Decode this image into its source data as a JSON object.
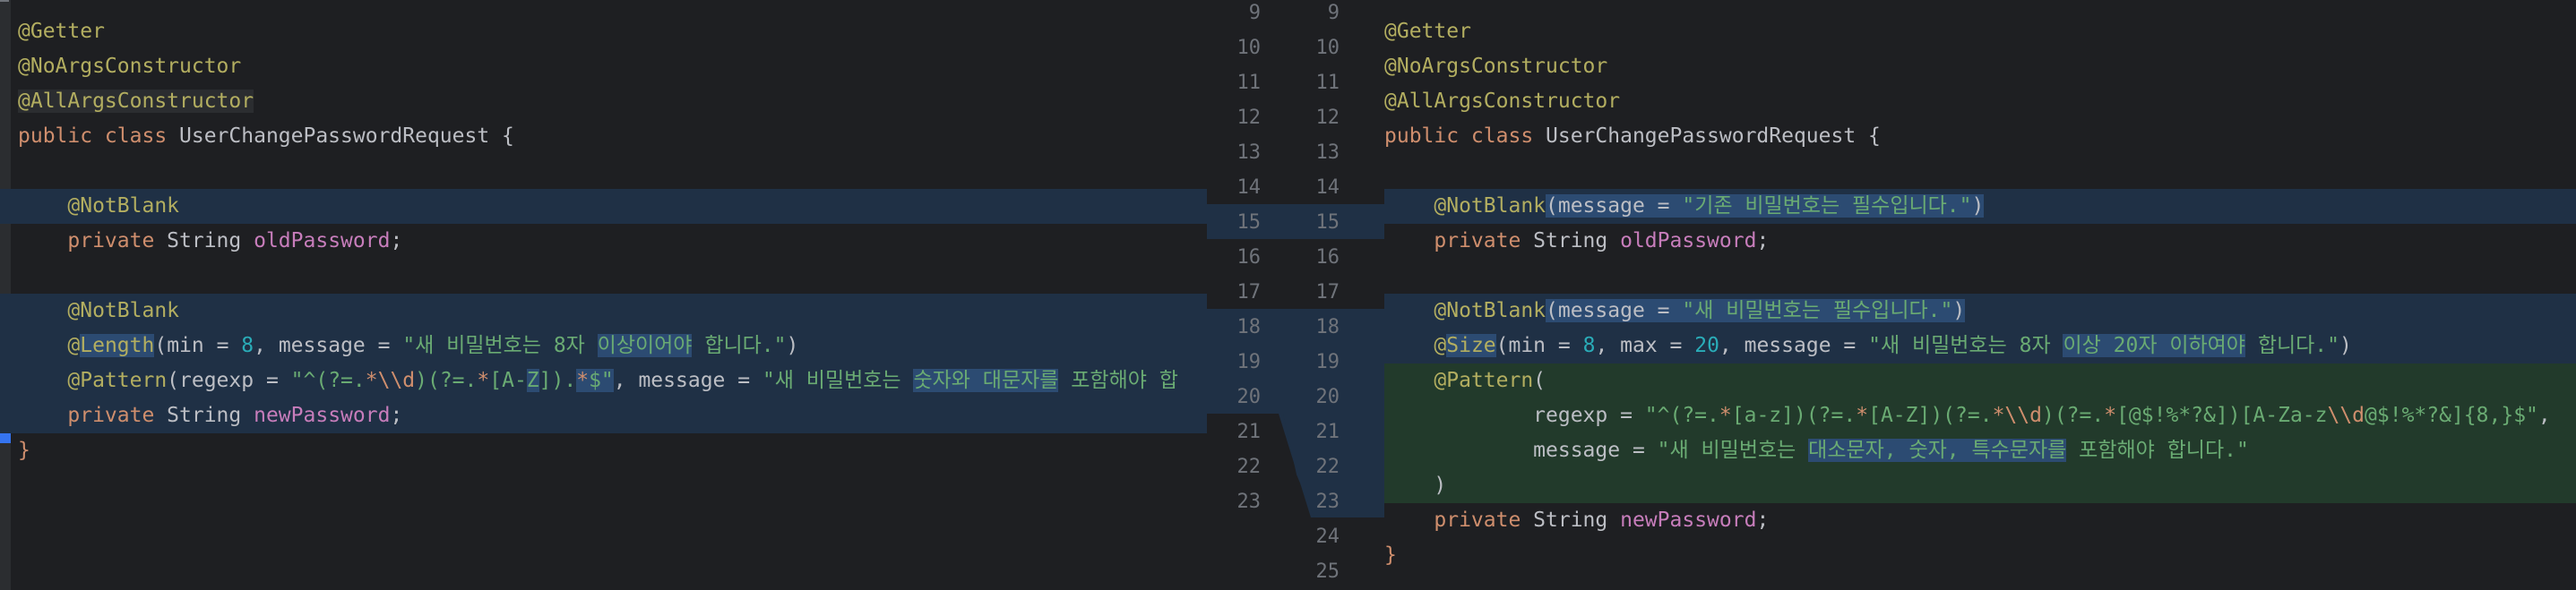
{
  "left": {
    "lines": [
      {
        "segs": [
          {
            "t": "@Getter",
            "c": "ann"
          }
        ]
      },
      {
        "segs": [
          {
            "t": "@NoArgsConstructor",
            "c": "ann"
          }
        ]
      },
      {
        "segs": [
          {
            "t": "@AllArgsConstructor",
            "c": "ann annbox"
          }
        ]
      },
      {
        "segs": [
          {
            "t": "public class ",
            "c": "kw"
          },
          {
            "t": "UserChangePasswordRequest {",
            "c": ""
          }
        ]
      },
      {
        "segs": [
          {
            "t": "",
            "c": ""
          }
        ]
      },
      {
        "segs": [
          {
            "t": "    @NotBlank",
            "c": "ann"
          }
        ]
      },
      {
        "segs": [
          {
            "t": "    private ",
            "c": "kw"
          },
          {
            "t": "String ",
            "c": ""
          },
          {
            "t": "oldPassword",
            "c": "fld"
          },
          {
            "t": ";",
            "c": ""
          }
        ]
      },
      {
        "segs": [
          {
            "t": "",
            "c": ""
          }
        ]
      },
      {
        "segs": [
          {
            "t": "    @NotBlank",
            "c": "ann"
          }
        ]
      },
      {
        "segs": [
          {
            "t": "    @",
            "c": "ann"
          },
          {
            "t": "Length",
            "c": "ann chg"
          },
          {
            "t": "(min = ",
            "c": ""
          },
          {
            "t": "8",
            "c": "num"
          },
          {
            "t": ", message = ",
            "c": ""
          },
          {
            "t": "\"새 비밀번호는 8자 ",
            "c": "str"
          },
          {
            "t": "이상이어야",
            "c": "str chg"
          },
          {
            "t": " 합니다.\"",
            "c": "str"
          },
          {
            "t": ")",
            "c": ""
          }
        ]
      },
      {
        "segs": [
          {
            "t": "    @Pattern",
            "c": "ann"
          },
          {
            "t": "(regexp = ",
            "c": ""
          },
          {
            "t": "\"^(?=.",
            "c": "str"
          },
          {
            "t": "*\\\\d",
            "c": "esc"
          },
          {
            "t": ")(?=.",
            "c": "str"
          },
          {
            "t": "*",
            "c": "esc"
          },
          {
            "t": "[A-",
            "c": "str"
          },
          {
            "t": "Z",
            "c": "str chg"
          },
          {
            "t": "]).",
            "c": "str"
          },
          {
            "t": "*",
            "c": "esc chg"
          },
          {
            "t": "$\"",
            "c": "str chg"
          },
          {
            "t": ", message = ",
            "c": ""
          },
          {
            "t": "\"새 비밀번호는 ",
            "c": "str"
          },
          {
            "t": "숫자와 대문자를",
            "c": "str chg"
          },
          {
            "t": " 포함해야 합",
            "c": "str"
          }
        ]
      },
      {
        "segs": [
          {
            "t": "    private ",
            "c": "kw"
          },
          {
            "t": "String ",
            "c": ""
          },
          {
            "t": "newPassword",
            "c": "fld"
          },
          {
            "t": ";",
            "c": ""
          }
        ]
      },
      {
        "segs": [
          {
            "t": "}",
            "c": "kw"
          }
        ]
      }
    ]
  },
  "gutter": {
    "left_numbers": [
      "9",
      "10",
      "11",
      "12",
      "13",
      "14",
      "15",
      "16",
      "17",
      "18",
      "19",
      "20",
      "21",
      "22",
      "23"
    ],
    "right_numbers": [
      "9",
      "10",
      "11",
      "12",
      "13",
      "14",
      "15",
      "16",
      "17",
      "18",
      "19",
      "20",
      "21",
      "22",
      "23",
      "24",
      "25"
    ]
  },
  "right": {
    "lines": [
      {
        "segs": [
          {
            "t": "@Getter",
            "c": "ann"
          }
        ]
      },
      {
        "segs": [
          {
            "t": "@NoArgsConstructor",
            "c": "ann"
          }
        ]
      },
      {
        "segs": [
          {
            "t": "@AllArgsConstructor",
            "c": "ann"
          }
        ]
      },
      {
        "segs": [
          {
            "t": "public class ",
            "c": "kw"
          },
          {
            "t": "UserChangePasswordRequest {",
            "c": ""
          }
        ]
      },
      {
        "segs": [
          {
            "t": "",
            "c": ""
          }
        ]
      },
      {
        "segs": [
          {
            "t": "    @NotBlank",
            "c": "ann"
          },
          {
            "t": "(message = ",
            "c": "chg"
          },
          {
            "t": "\"기존 비밀번호는 필수입니다.\"",
            "c": "str chg"
          },
          {
            "t": ")",
            "c": "chg"
          }
        ]
      },
      {
        "segs": [
          {
            "t": "    private ",
            "c": "kw"
          },
          {
            "t": "String ",
            "c": ""
          },
          {
            "t": "oldPassword",
            "c": "fld"
          },
          {
            "t": ";",
            "c": ""
          }
        ]
      },
      {
        "segs": [
          {
            "t": "",
            "c": ""
          }
        ]
      },
      {
        "segs": [
          {
            "t": "    @NotBlank",
            "c": "ann"
          },
          {
            "t": "(message = ",
            "c": "chg"
          },
          {
            "t": "\"새 비밀번호는 필수입니다.\"",
            "c": "str chg"
          },
          {
            "t": ")",
            "c": "chg"
          }
        ]
      },
      {
        "segs": [
          {
            "t": "    @",
            "c": "ann"
          },
          {
            "t": "Size",
            "c": "ann chg"
          },
          {
            "t": "(min = ",
            "c": ""
          },
          {
            "t": "8",
            "c": "num"
          },
          {
            "t": ", max = ",
            "c": ""
          },
          {
            "t": "20",
            "c": "num"
          },
          {
            "t": ", message = ",
            "c": ""
          },
          {
            "t": "\"새 비밀번호는 8자 ",
            "c": "str"
          },
          {
            "t": "이상 20자 이하여야",
            "c": "str chg"
          },
          {
            "t": " 합니다.\"",
            "c": "str"
          },
          {
            "t": ")",
            "c": ""
          }
        ]
      },
      {
        "segs": [
          {
            "t": "    @Pattern",
            "c": "ann"
          },
          {
            "t": "(",
            "c": ""
          }
        ]
      },
      {
        "segs": [
          {
            "t": "            regexp = ",
            "c": ""
          },
          {
            "t": "\"^(?=.",
            "c": "str"
          },
          {
            "t": "*",
            "c": "esc"
          },
          {
            "t": "[a-z])(?=.",
            "c": "str"
          },
          {
            "t": "*",
            "c": "esc"
          },
          {
            "t": "[A-Z])(?=.",
            "c": "str"
          },
          {
            "t": "*\\\\d",
            "c": "esc"
          },
          {
            "t": ")(?=.",
            "c": "str"
          },
          {
            "t": "*",
            "c": "esc"
          },
          {
            "t": "[@$!%*?&])[A-Za-z",
            "c": "str"
          },
          {
            "t": "\\\\d",
            "c": "esc"
          },
          {
            "t": "@$!%*?&]{8,}$\"",
            "c": "str"
          },
          {
            "t": ",",
            "c": ""
          }
        ]
      },
      {
        "segs": [
          {
            "t": "            message = ",
            "c": ""
          },
          {
            "t": "\"새 비밀번호는 ",
            "c": "str"
          },
          {
            "t": "대소문자, 숫자, 특수문자를",
            "c": "str chg"
          },
          {
            "t": " 포함해야 합니다.\"",
            "c": "str"
          }
        ]
      },
      {
        "segs": [
          {
            "t": "    )",
            "c": ""
          }
        ]
      },
      {
        "segs": [
          {
            "t": "    private ",
            "c": "kw"
          },
          {
            "t": "String ",
            "c": ""
          },
          {
            "t": "newPassword",
            "c": "fld"
          },
          {
            "t": ";",
            "c": ""
          }
        ]
      },
      {
        "segs": [
          {
            "t": "}",
            "c": "kw"
          }
        ]
      }
    ]
  }
}
